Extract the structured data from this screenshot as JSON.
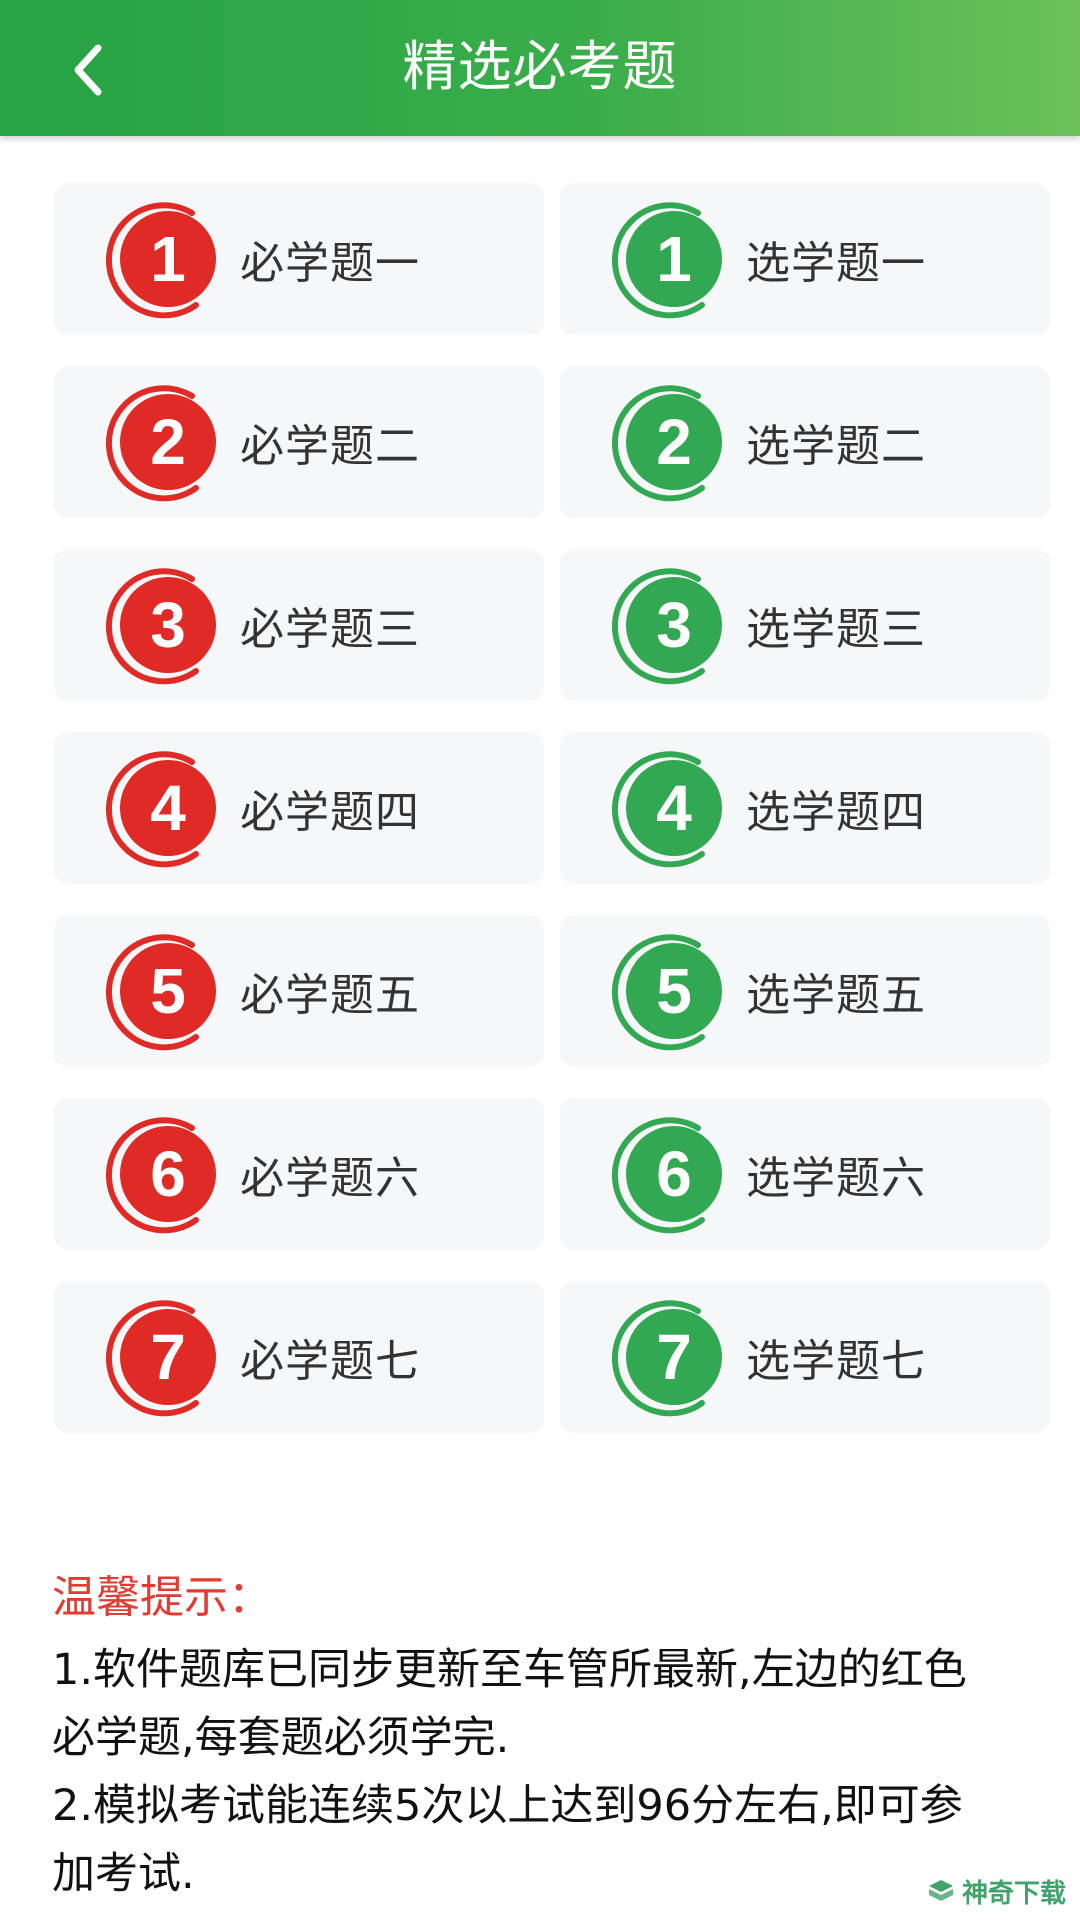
{
  "header": {
    "title": "精选必考题",
    "back_icon": "chevron-left-icon"
  },
  "colors": {
    "header_gradient_start": "#25a345",
    "header_gradient_end": "#6cc15a",
    "required_badge": "#e02a25",
    "optional_badge": "#33a852",
    "card_bg": "#f6f7f8",
    "tips_title": "#e03c31"
  },
  "cards": [
    {
      "number": "1",
      "required_label": "必学题一",
      "optional_label": "选学题一"
    },
    {
      "number": "2",
      "required_label": "必学题二",
      "optional_label": "选学题二"
    },
    {
      "number": "3",
      "required_label": "必学题三",
      "optional_label": "选学题三"
    },
    {
      "number": "4",
      "required_label": "必学题四",
      "optional_label": "选学题四"
    },
    {
      "number": "5",
      "required_label": "必学题五",
      "optional_label": "选学题五"
    },
    {
      "number": "6",
      "required_label": "必学题六",
      "optional_label": "选学题六"
    },
    {
      "number": "7",
      "required_label": "必学题七",
      "optional_label": "选学题七"
    }
  ],
  "tips": {
    "title": "温馨提示：",
    "lines": [
      "1.软件题库已同步更新至车管所最新,左边的红色",
      "必学题,每套题必须学完.",
      "2.模拟考试能连续5次以上达到96分左右,即可参",
      "加考试."
    ]
  },
  "watermark": {
    "text": "神奇下载",
    "icon": "box-logo-icon"
  }
}
